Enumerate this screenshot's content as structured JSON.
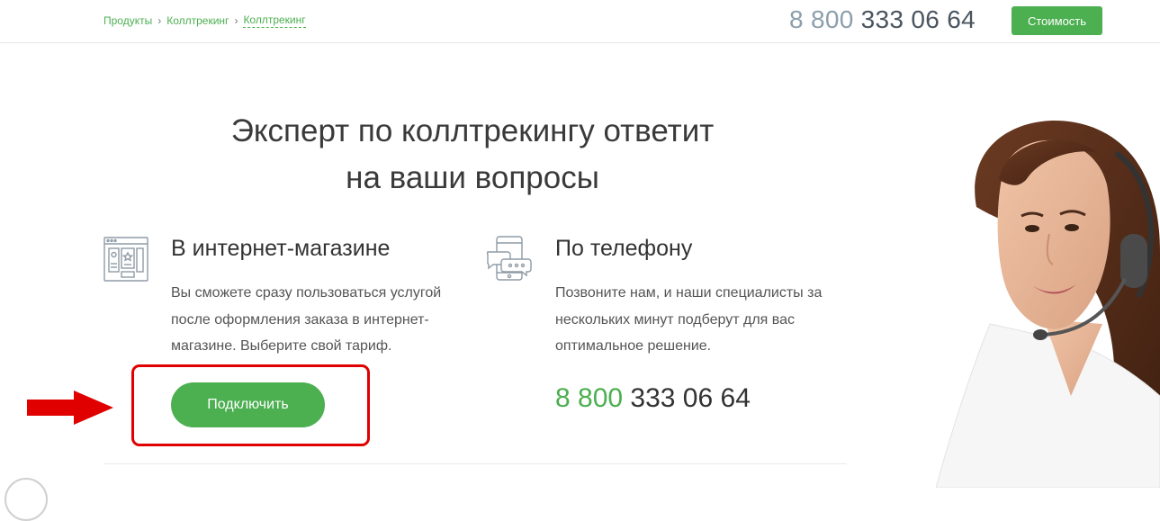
{
  "header": {
    "breadcrumbs": [
      "Продукты",
      "Коллтрекинг",
      "Коллтрекинг"
    ],
    "breadcrumb_separator": "›",
    "phone_prefix": "8 800",
    "phone_number": "333 06 64",
    "cost_button": "Стоимость"
  },
  "hero": {
    "title_line1": "Эксперт по коллтрекингу ответит",
    "title_line2": "на ваши вопросы"
  },
  "online": {
    "icon": "online-store-icon",
    "heading": "В интернет-магазине",
    "text_line1": "Вы сможете сразу пользоваться услугой",
    "text_line2": "после оформления заказа в интернет-",
    "text_line3": "магазине. Выберите свой тариф.",
    "button": "Подключить"
  },
  "phone": {
    "icon": "phone-chat-icon",
    "heading": "По телефону",
    "text_line1": "Позвоните нам, и наши специалисты за",
    "text_line2": "нескольких минут подберут для вас",
    "text_line3": "оптимальное решение.",
    "number_prefix": "8 800",
    "number": "333 06 64"
  },
  "colors": {
    "accent": "#4caf50",
    "highlight": "#e00000"
  }
}
